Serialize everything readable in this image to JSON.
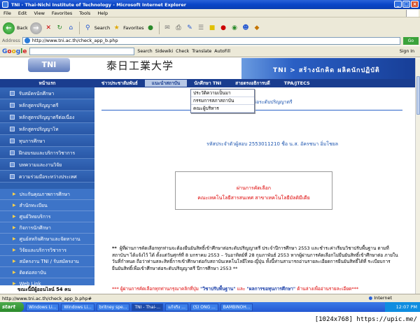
{
  "window": {
    "title": "TNI - Thai-Nichi Institute of Technology - Microsoft Internet Explorer",
    "buttons": [
      "_",
      "□",
      "×"
    ]
  },
  "menu": [
    "File",
    "Edit",
    "View",
    "Favorites",
    "Tools",
    "Help"
  ],
  "toolbar": {
    "back": "Back",
    "search": "Search",
    "favorites": "Favorites"
  },
  "address": {
    "label": "Address",
    "url": "http://www.tni.ac.th/check_app_b.php",
    "go": "Go"
  },
  "googlebar": {
    "logo": "Google",
    "search": "Search",
    "sidewiki": "Sidewiki",
    "check": "Check",
    "translate": "Translate",
    "autofill": "AutoFill",
    "signin": "Sign In"
  },
  "banner": {
    "logo": "TNI",
    "japanese": "泰日工業大学",
    "slogan": "TNI > สร้างนักคิด  ผลิตนักปฏิบัติ"
  },
  "topnav": {
    "home": "หน้าแรก",
    "items": [
      "ข่าวประชาสัมพันธ์",
      "แนะนำสถาบัน",
      "นักศึกษา TNI",
      "สายตรงอธิการบดี",
      "TPA/JTECS"
    ]
  },
  "dropdown": [
    "ประวัติความเป็นมา",
    "กรรมการสภาสถาบัน",
    "คณะผู้บริหาร"
  ],
  "sidebar": {
    "group1": [
      "รับสมัครนักศึกษา",
      "หลักสูตรปริญญาตรี",
      "หลักสูตรปริญญาตรีต่อเนื่อง",
      "หลักสูตรปริญญาโท",
      "ทุนการศึกษา",
      "ฝึกอบรมและบริการวิชาการ",
      "บทความและงานวิจัย",
      "ความร่วมมือระหว่างประเทศ"
    ],
    "group2": [
      "ประกันคุณภาพการศึกษา",
      "สำนักทะเบียน",
      "ศูนย์วิทยบริการ",
      "กิจการนักศึกษา",
      "ศูนย์สหกิจศึกษาและจัดหางาน",
      "วิจัยและบริการวิชาการ",
      "สมัครงาน TNI / รับสมัครงาน",
      "ติดต่อสถาบัน",
      "Web Link"
    ],
    "visitors": "ขณะนี้มีผู้ออนไลน์ 54 คน"
  },
  "content": {
    "title": "ศึกษาต่อระดับปริญญาตรี",
    "app_line": "รหัสประจำตัวผู้สอบ  2553011210     ชื่อ  น.ส. อัครชนา อิ่มโชยล",
    "result_status": "ผ่านการคัดเลือก",
    "result_program": "คณะเทคโนโลยีสารสนเทศ สาขาเทคโนโลยีมัลติมีเดีย",
    "notice_star": "**",
    "notice_text": "ผู้ที่ผ่านการคัดเลือกทุกท่านจะต้องยืนยันสิทธิ์เข้าศึกษาต่อระดับปริญญาตรี ประจำปีการศึกษา 2553 และชำระค่าเรียนวิชาปรับพื้นฐาน ตามที่สถาบันฯ ได้แจ้งไว้ ได้ ตั้งแต่วันศุกร์ที่ 8 มกราคม 2553 – วันอาทิตย์ที่ 28 กุมภาพันธ์ 2553 หากผู้ผ่านการคัดเลือกไม่ยืนยันสิทธิ์เข้าศึกษาต่อ ภายในวันที่กำหนด ถือว่าท่านสละสิทธิ์การเข้าศึกษาต่อกับสถาบันเทคโนโลยีไทย-ญี่ปุ่น ทั้งนี้ท่านสามารถอ่านรายละเอียดการยืนยันสิทธิ์ได้ที่ ระเบียบการยืนยันสิทธิ์เพื่อเข้าศึกษาต่อระดับปริญญาตรี ปีการศึกษา 2553 **",
    "note2_prefix": "*** ผู้ผ่านการคัดเลือกทุกท่านกรุณาคลิกที่ปุ่ม ",
    "note2_link1": "\"วิชาปรับพื้นฐาน\"",
    "note2_mid": " และ ",
    "note2_link2": "\"ผลการขอทุนการศึกษา\"",
    "note2_suffix": " ด้านล่างเพื่ออ่านรายละเอียด***"
  },
  "status": {
    "text": "http://www.tni.ac.th/check_app_b.php#",
    "zone": "Internet"
  },
  "taskbar": {
    "start": "start",
    "tasks": [
      "Windows Li...",
      "Windows Li...",
      "britney spe...",
      "TNI - Thai-...",
      "แก้จริง ...",
      "(S) ONG ...",
      "BAMBINOH..."
    ],
    "time": "12:07 PM"
  },
  "watermark": "[1024x768] https://upic.me/",
  "colors": {
    "nav": "#1a3d8f",
    "sidebar": "#2d60b0",
    "result": "#dd0000"
  }
}
